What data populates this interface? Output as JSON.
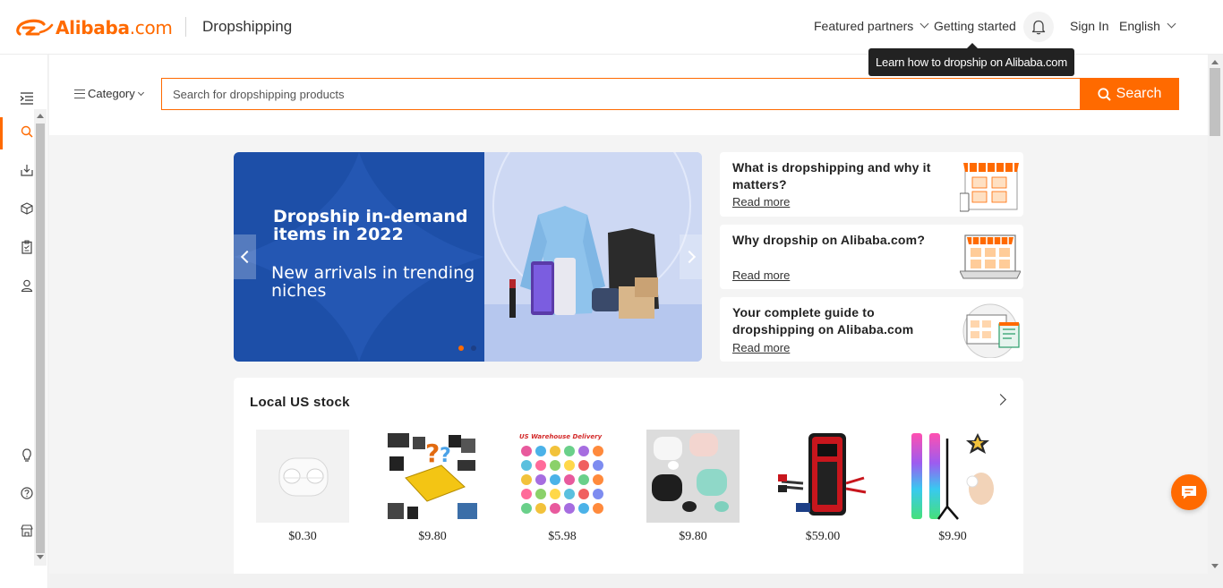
{
  "header": {
    "logo_text": "Alibaba",
    "logo_suffix": ".com",
    "section_title": "Dropshipping",
    "nav": {
      "featured_partners": "Featured partners",
      "getting_started": "Getting started",
      "sign_in": "Sign In",
      "language": "English"
    },
    "tooltip": "Learn how to dropship on Alibaba.com"
  },
  "search": {
    "category_label": "Category",
    "placeholder": "Search for dropshipping products",
    "button_label": "Search"
  },
  "banner": {
    "headline": "Dropship in-demand items in 2022",
    "subline": "New arrivals in trending niches",
    "active_slide": 1,
    "slide_count": 2
  },
  "info_cards": [
    {
      "title": "What is dropshipping and why it matters?",
      "link": "Read more"
    },
    {
      "title": "Why dropship on Alibaba.com?",
      "link": "Read more"
    },
    {
      "title": "Your complete guide to dropshipping on Alibaba.com",
      "link": "Read more"
    }
  ],
  "local_stock": {
    "title": "Local US stock",
    "products": [
      {
        "price": "$0.30",
        "image": "white-earbuds"
      },
      {
        "price": "$9.80",
        "image": "mystery-box-electronics"
      },
      {
        "price": "$5.98",
        "image": "colorful-slippers",
        "image_text": "US Warehouse Delivery"
      },
      {
        "price": "$9.80",
        "image": "wireless-earbuds-set"
      },
      {
        "price": "$59.00",
        "image": "jump-starter"
      },
      {
        "price": "$9.90",
        "image": "rgb-floor-lamp"
      }
    ]
  },
  "colors": {
    "accent": "#ff6a00",
    "banner_blue": "#1d4fa8",
    "banner_light": "#c9d6f2"
  }
}
